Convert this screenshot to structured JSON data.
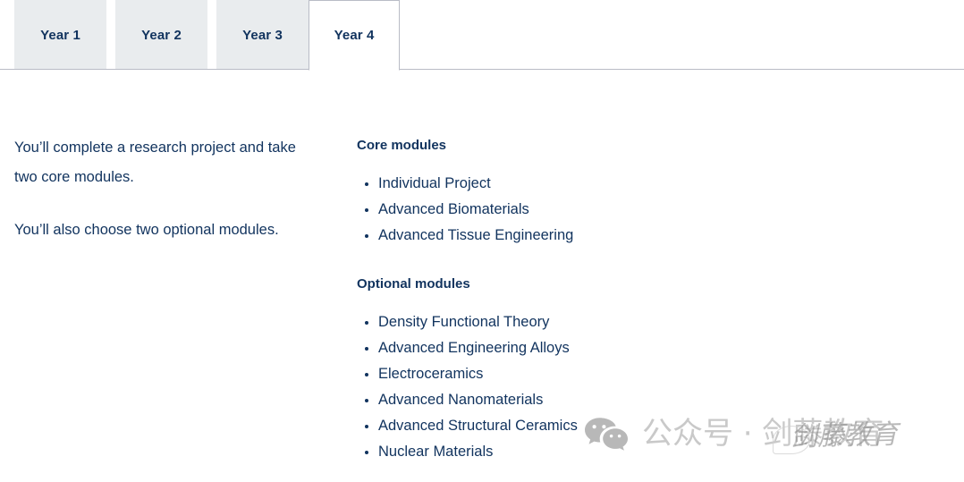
{
  "tabs": {
    "items": [
      {
        "label": "Year 1",
        "active": false
      },
      {
        "label": "Year 2",
        "active": false
      },
      {
        "label": "Year 3",
        "active": false
      },
      {
        "label": "Year 4",
        "active": true
      }
    ]
  },
  "colors": {
    "text_navy": "#11335e",
    "tab_inactive_bg": "#e9ecee",
    "tab_active_bg": "#ffffff",
    "border": "#b9bcc6",
    "watermark_gray": "#c9c9c9",
    "watermark_icon_gray": "#b8b8b8",
    "watermark_overlay_gray": "#8e8e8e"
  },
  "overview": {
    "paragraphs": [
      "You’ll complete a research project and take two core modules.",
      "You’ll also choose two optional modules."
    ]
  },
  "modules": {
    "core": {
      "heading": "Core modules",
      "items": [
        "Individual Project",
        "Advanced Biomaterials",
        "Advanced Tissue Engineering"
      ]
    },
    "optional": {
      "heading": "Optional modules",
      "items": [
        "Density Functional Theory",
        "Advanced Engineering Alloys",
        "Electroceramics",
        "Advanced Nanomaterials",
        "Advanced Structural Ceramics",
        "Nuclear Materials"
      ]
    }
  },
  "watermark": {
    "icon": "wechat-icon",
    "text": "公众号 · 剑藤教育",
    "overlay_text": "剑藤教育"
  }
}
